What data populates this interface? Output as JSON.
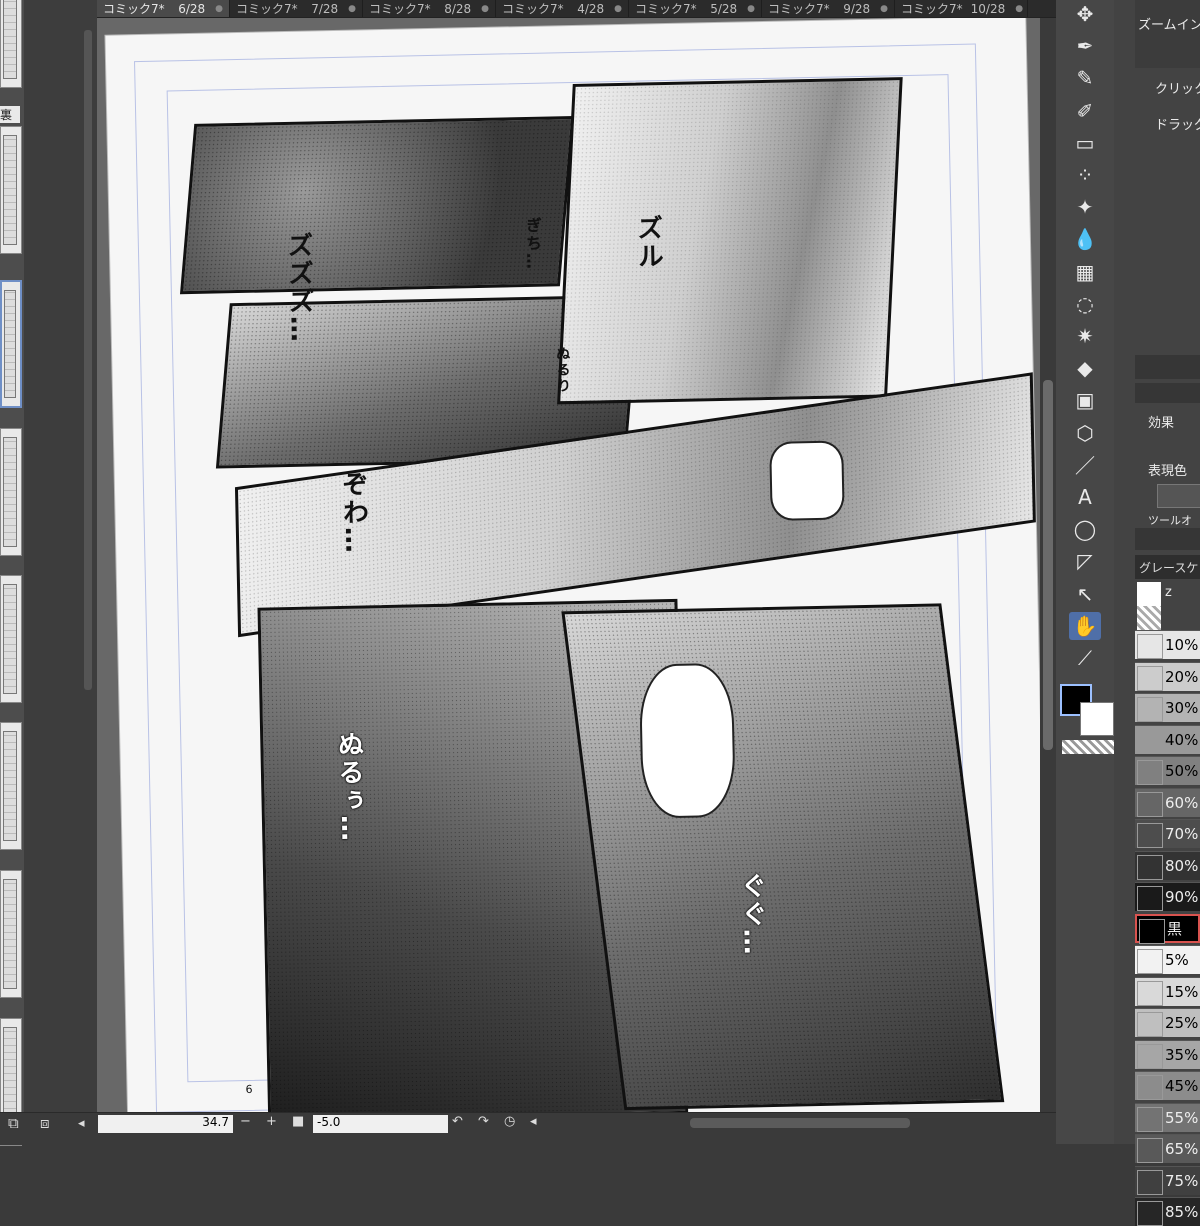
{
  "tabs": [
    {
      "name": "コミック7*",
      "page": "6/28",
      "active": true
    },
    {
      "name": "コミック7*",
      "page": "7/28",
      "active": false
    },
    {
      "name": "コミック7*",
      "page": "8/28",
      "active": false
    },
    {
      "name": "コミック7*",
      "page": "4/28",
      "active": false
    },
    {
      "name": "コミック7*",
      "page": "5/28",
      "active": false
    },
    {
      "name": "コミック7*",
      "page": "9/28",
      "active": false
    },
    {
      "name": "コミック7*",
      "page": "10/28",
      "active": false
    }
  ],
  "page_strip": {
    "label": "裏"
  },
  "canvas": {
    "page_number": "6",
    "sfx": [
      "ズズズ…",
      "ぎち…",
      "ズル",
      "ぬるり",
      "ぞわ…",
      "ぬるぅ…",
      "ぐぐ…"
    ]
  },
  "tools": [
    {
      "icon": "move-layer-icon",
      "glyph": "✥",
      "active": false
    },
    {
      "icon": "pen-icon",
      "glyph": "✒",
      "active": false
    },
    {
      "icon": "pencil-icon",
      "glyph": "✎",
      "active": false
    },
    {
      "icon": "brush-icon",
      "glyph": "✐",
      "active": false
    },
    {
      "icon": "eraser-icon",
      "glyph": "▭",
      "active": false
    },
    {
      "icon": "airbrush-icon",
      "glyph": "⁘",
      "active": false
    },
    {
      "icon": "decoration-icon",
      "glyph": "✦",
      "active": false
    },
    {
      "icon": "blend-icon",
      "glyph": "💧",
      "active": false
    },
    {
      "icon": "figure-ruler-icon",
      "glyph": "▦",
      "active": false
    },
    {
      "icon": "lasso-icon",
      "glyph": "◌",
      "active": false
    },
    {
      "icon": "auto-select-icon",
      "glyph": "✷",
      "active": false
    },
    {
      "icon": "fill-icon",
      "glyph": "◆",
      "active": false
    },
    {
      "icon": "gradient-icon",
      "glyph": "▣",
      "active": false
    },
    {
      "icon": "3d-object-icon",
      "glyph": "⬡",
      "active": false
    },
    {
      "icon": "line-icon",
      "glyph": "／",
      "active": false
    },
    {
      "icon": "text-icon",
      "glyph": "A",
      "active": false
    },
    {
      "icon": "balloon-icon",
      "glyph": "◯",
      "active": false
    },
    {
      "icon": "frame-border-icon",
      "glyph": "◸",
      "active": false
    },
    {
      "icon": "operation-icon",
      "glyph": "↖",
      "active": false
    },
    {
      "icon": "hand-icon",
      "glyph": "✋",
      "active": true
    },
    {
      "icon": "eyedropper-icon",
      "glyph": "⟋",
      "active": false
    }
  ],
  "right_panel": {
    "zoom_title": "ズームイン",
    "click_label": "クリック",
    "drag_label": "ドラッグ",
    "effect_label": "効果",
    "expression_color_label": "表現色",
    "tool_label": "ツールオ",
    "gray_title": "グレースケ",
    "gray_header_z": "z",
    "gray_levels": [
      {
        "label": "10%",
        "color": "#e6e6e6"
      },
      {
        "label": "20%",
        "color": "#cccccc"
      },
      {
        "label": "30%",
        "color": "#b3b3b3"
      },
      {
        "label": "40%",
        "color": "#999999"
      },
      {
        "label": "50%",
        "color": "#808080"
      },
      {
        "label": "60%",
        "color": "#666666"
      },
      {
        "label": "70%",
        "color": "#4d4d4d"
      },
      {
        "label": "80%",
        "color": "#333333"
      },
      {
        "label": "90%",
        "color": "#1a1a1a"
      },
      {
        "label": "黒",
        "color": "#000000"
      },
      {
        "label": "5%",
        "color": "#f2f2f2"
      },
      {
        "label": "15%",
        "color": "#d9d9d9"
      },
      {
        "label": "25%",
        "color": "#bfbfbf"
      },
      {
        "label": "35%",
        "color": "#a6a6a6"
      },
      {
        "label": "45%",
        "color": "#8c8c8c"
      },
      {
        "label": "55%",
        "color": "#737373"
      },
      {
        "label": "65%",
        "color": "#595959"
      },
      {
        "label": "75%",
        "color": "#404040"
      },
      {
        "label": "85%",
        "color": "#262626"
      }
    ]
  },
  "status": {
    "zoom_value": "34.7",
    "zoom_minus": "−",
    "zoom_plus": "+",
    "angle_value": "-5.0",
    "undo_glyph": "↶",
    "redo_glyph": "↷"
  },
  "colors": {
    "accent": "#4f6fa8",
    "selected_swatch_border": "#d9534f"
  }
}
